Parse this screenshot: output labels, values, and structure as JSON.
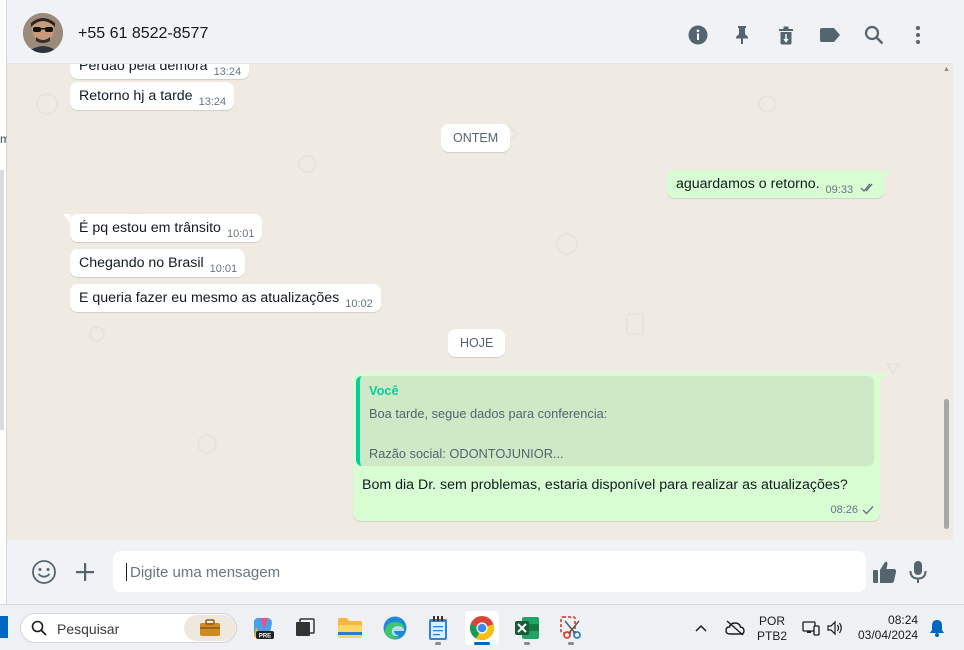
{
  "header": {
    "contact_name": "+55 61 8522-8577",
    "icons": [
      "info-icon",
      "pin-icon",
      "trash-icon",
      "label-icon",
      "search-icon",
      "menu-dots-icon"
    ]
  },
  "messages": {
    "m0": {
      "text": "Perdão pela demora",
      "time": "13:24"
    },
    "m1": {
      "text": "Retorno hj a tarde",
      "time": "13:24"
    },
    "divider_ontem": "ONTEM",
    "m2": {
      "text": "aguardamos o retorno.",
      "time": "09:33"
    },
    "m3": {
      "text": "É pq estou em trânsito",
      "time": "10:01"
    },
    "m4": {
      "text": "Chegando no Brasil",
      "time": "10:01"
    },
    "m5": {
      "text": "E queria fazer eu mesmo as atualizações",
      "time": "10:02"
    },
    "divider_hoje": "HOJE",
    "m6": {
      "quote_author": "Você",
      "quote_text": "Boa tarde, segue dados para conferencia:\n\nRazão social: ODONTOJUNIOR...",
      "text": "Bom dia Dr. sem problemas, estaria disponível para realizar as atualizações?",
      "time": "08:26"
    }
  },
  "composer": {
    "placeholder": "Digite uma mensagem"
  },
  "taskbar": {
    "search_label": "Pesquisar",
    "lang_line1": "POR",
    "lang_line2": "PTB2",
    "time": "08:24",
    "date": "03/04/2024"
  },
  "colors": {
    "outgoing_bubble": "#d9fdd3",
    "incoming_bubble": "#ffffff",
    "chat_background": "#efeae2",
    "quote_accent": "#06cf9c",
    "read_ticks": "#667781"
  }
}
